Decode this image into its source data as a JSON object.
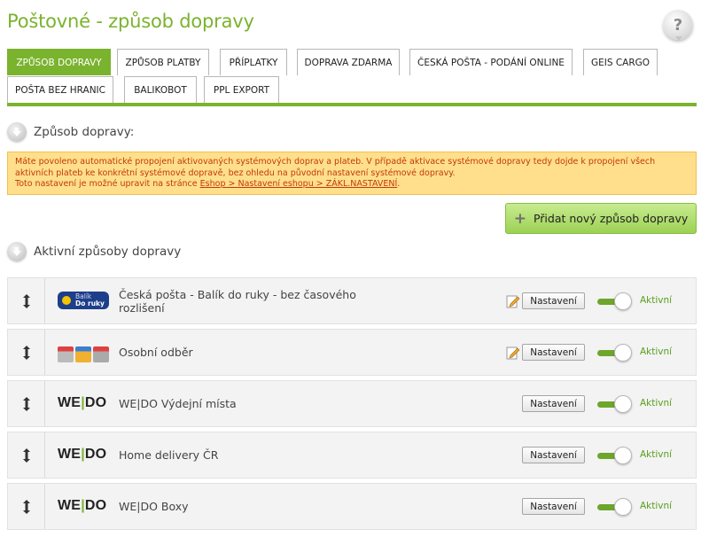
{
  "page": {
    "title": "Poštovné - způsob dopravy",
    "help_label": "?"
  },
  "tabs": [
    {
      "label": "ZPŮSOB DOPRAVY",
      "active": true
    },
    {
      "label": "ZPŮSOB PLATBY"
    },
    {
      "label": "PŘÍPLATKY"
    },
    {
      "label": "DOPRAVA ZDARMA"
    },
    {
      "label": "ČESKÁ POŠTA - PODÁNÍ ONLINE"
    },
    {
      "label": "GEIS CARGO"
    },
    {
      "label": "POŠTA BEZ HRANIC"
    },
    {
      "label": "BALIKOBOT"
    },
    {
      "label": "PPL EXPORT"
    }
  ],
  "sections": {
    "shipping_method": "Způsob dopravy:",
    "active_methods": "Aktivní způsoby dopravy"
  },
  "warning": {
    "line1": "Máte povoleno automatické propojení aktivovaných systémových doprav a plateb. V případě aktivace systémové dopravy tedy dojde k propojení všech aktivních plateb ke konkrétní systémové dopravě, bez ohledu na původní nastavení systémové dopravy.",
    "line2_prefix": "Toto nastavení je možné upravit na stránce ",
    "link": "Eshop > Nastavení eshopu > ZÁKL.NASTAVENÍ",
    "line2_suffix": "."
  },
  "add_button": {
    "icon": "plus-icon",
    "label": "Přidat nový způsob dopravy"
  },
  "methods": [
    {
      "logo": "balik-do-ruky-logo",
      "logo_text_1": "Balík",
      "logo_text_2": "Do ruky",
      "name": "Česká pošta - Balík do ruky - bez časového rozlišení",
      "has_edit": true,
      "settings": "Nastavení",
      "status": "Aktivní",
      "enabled": true
    },
    {
      "logo": "shop-pickup-logo",
      "name": "Osobní odběr",
      "has_edit": true,
      "settings": "Nastavení",
      "status": "Aktivní",
      "enabled": true
    },
    {
      "logo": "wedo-logo",
      "logo_text_1": "WE",
      "logo_text_bar": "|",
      "logo_text_2": "DO",
      "name": "WE|DO Výdejní místa",
      "has_edit": false,
      "settings": "Nastavení",
      "status": "Aktivní",
      "enabled": true
    },
    {
      "logo": "wedo-logo",
      "logo_text_1": "WE",
      "logo_text_bar": "|",
      "logo_text_2": "DO",
      "name": "Home delivery ČR",
      "has_edit": false,
      "settings": "Nastavení",
      "status": "Aktivní",
      "enabled": true
    },
    {
      "logo": "wedo-logo",
      "logo_text_1": "WE",
      "logo_text_bar": "|",
      "logo_text_2": "DO",
      "name": "WE|DO Boxy",
      "has_edit": false,
      "settings": "Nastavení",
      "status": "Aktivní",
      "enabled": true
    }
  ],
  "colors": {
    "accent": "#7ab32e",
    "warning_bg": "#ffdf8c",
    "warning_text": "#c0390c",
    "status": "#5a9e1e"
  }
}
